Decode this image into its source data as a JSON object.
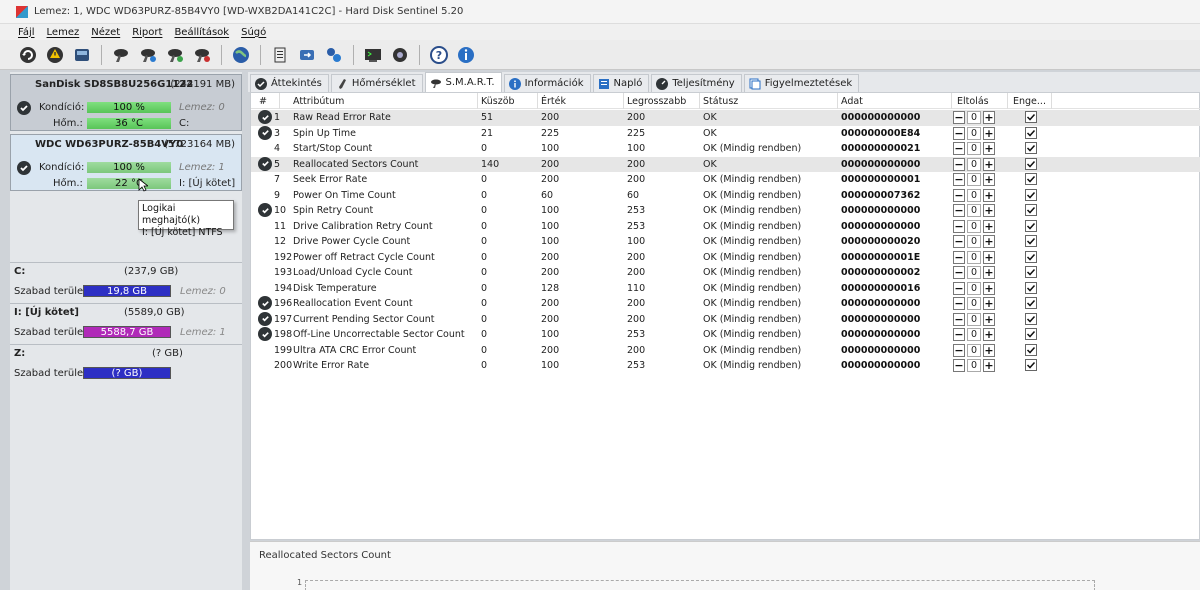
{
  "window": {
    "title": "Lemez: 1, WDC WD63PURZ-85B4VY0 [WD-WXB2DA141C2C]  -  Hard Disk Sentinel 5.20"
  },
  "menu": [
    "Fájl",
    "Lemez",
    "Nézet",
    "Riport",
    "Beállítások",
    "Súgó"
  ],
  "toolbar_icons": [
    "refresh-icon",
    "warning-icon",
    "disk-icon",
    "wrench-icon",
    "wrench-blue-icon",
    "wrench-green-icon",
    "wrench-red-icon",
    "globe-icon",
    "document-icon",
    "sync-icon",
    "network-icon",
    "terminal-icon",
    "settings-icon",
    "help-icon",
    "info-icon"
  ],
  "disks": [
    {
      "name": "SanDisk SD8SB8U256G1122",
      "size": "(244191 MB)",
      "condition_label": "Kondíció:",
      "condition": "100 %",
      "condition_right": "Lemez: 0",
      "temp_label": "Hőm.:",
      "temp": "36 °C",
      "temp_right": "C:"
    },
    {
      "name": "WDC WD63PURZ-85B4VY0",
      "size": "(5723164 MB)",
      "condition_label": "Kondíció:",
      "condition": "100 %",
      "condition_right": "Lemez: 1",
      "temp_label": "Hőm.:",
      "temp": "22 °C",
      "temp_right": "I: [Új kötet]"
    }
  ],
  "tooltip": {
    "line1": "Logikai meghajtó(k)",
    "line2": "I: [Új kötet] NTFS"
  },
  "volumes": [
    {
      "name": "C:",
      "size": "(237,9 GB)",
      "free_label": "Szabad terület",
      "free": "19,8 GB",
      "disk": "Lemez: 0",
      "color": "#2d2fc4"
    },
    {
      "name": "I: [Új kötet]",
      "size": "(5589,0 GB)",
      "free_label": "Szabad terület",
      "free": "5588,7 GB",
      "disk": "Lemez: 1",
      "color": "#b02ab8"
    },
    {
      "name": "Z:",
      "size": "(? GB)",
      "free_label": "Szabad terület",
      "free": "(? GB)",
      "disk": "",
      "color": "#2d2fc4"
    }
  ],
  "tabs": [
    "Áttekintés",
    "Hőmérséklet",
    "S.M.A.R.T.",
    "Információk",
    "Napló",
    "Teljesítmény",
    "Figyelmeztetések"
  ],
  "table": {
    "headers": {
      "num": "#",
      "attr": "Attribútum",
      "threshold": "Küszöb",
      "value": "Érték",
      "worst": "Legrosszabb",
      "status": "Státusz",
      "data": "Adat",
      "offset": "Eltolás",
      "enable": "Enge..."
    },
    "rows": [
      {
        "check": true,
        "num": "1",
        "attr": "Raw Read Error Rate",
        "threshold": "51",
        "value": "200",
        "worst": "200",
        "status": "OK",
        "data": "000000000000",
        "offset": "0",
        "sel": true
      },
      {
        "check": true,
        "num": "3",
        "attr": "Spin Up Time",
        "threshold": "21",
        "value": "225",
        "worst": "225",
        "status": "OK",
        "data": "000000000E84",
        "offset": "0",
        "sel": false
      },
      {
        "check": false,
        "num": "4",
        "attr": "Start/Stop Count",
        "threshold": "0",
        "value": "100",
        "worst": "100",
        "status": "OK (Mindig rendben)",
        "data": "000000000021",
        "offset": "0",
        "sel": false
      },
      {
        "check": true,
        "num": "5",
        "attr": "Reallocated Sectors Count",
        "threshold": "140",
        "value": "200",
        "worst": "200",
        "status": "OK",
        "data": "000000000000",
        "offset": "0",
        "sel": true
      },
      {
        "check": false,
        "num": "7",
        "attr": "Seek Error Rate",
        "threshold": "0",
        "value": "200",
        "worst": "200",
        "status": "OK (Mindig rendben)",
        "data": "000000000001",
        "offset": "0",
        "sel": false
      },
      {
        "check": false,
        "num": "9",
        "attr": "Power On Time Count",
        "threshold": "0",
        "value": "60",
        "worst": "60",
        "status": "OK (Mindig rendben)",
        "data": "000000007362",
        "offset": "0",
        "sel": false
      },
      {
        "check": true,
        "num": "10",
        "attr": "Spin Retry Count",
        "threshold": "0",
        "value": "100",
        "worst": "253",
        "status": "OK (Mindig rendben)",
        "data": "000000000000",
        "offset": "0",
        "sel": false
      },
      {
        "check": false,
        "num": "11",
        "attr": "Drive Calibration Retry Count",
        "threshold": "0",
        "value": "100",
        "worst": "253",
        "status": "OK (Mindig rendben)",
        "data": "000000000000",
        "offset": "0",
        "sel": false
      },
      {
        "check": false,
        "num": "12",
        "attr": "Drive Power Cycle Count",
        "threshold": "0",
        "value": "100",
        "worst": "100",
        "status": "OK (Mindig rendben)",
        "data": "000000000020",
        "offset": "0",
        "sel": false
      },
      {
        "check": false,
        "num": "192",
        "attr": "Power off Retract Cycle Count",
        "threshold": "0",
        "value": "200",
        "worst": "200",
        "status": "OK (Mindig rendben)",
        "data": "00000000001E",
        "offset": "0",
        "sel": false
      },
      {
        "check": false,
        "num": "193",
        "attr": "Load/Unload Cycle Count",
        "threshold": "0",
        "value": "200",
        "worst": "200",
        "status": "OK (Mindig rendben)",
        "data": "000000000002",
        "offset": "0",
        "sel": false
      },
      {
        "check": false,
        "num": "194",
        "attr": "Disk Temperature",
        "threshold": "0",
        "value": "128",
        "worst": "110",
        "status": "OK (Mindig rendben)",
        "data": "000000000016",
        "offset": "0",
        "sel": false
      },
      {
        "check": true,
        "num": "196",
        "attr": "Reallocation Event Count",
        "threshold": "0",
        "value": "200",
        "worst": "200",
        "status": "OK (Mindig rendben)",
        "data": "000000000000",
        "offset": "0",
        "sel": false
      },
      {
        "check": true,
        "num": "197",
        "attr": "Current Pending Sector Count",
        "threshold": "0",
        "value": "200",
        "worst": "200",
        "status": "OK (Mindig rendben)",
        "data": "000000000000",
        "offset": "0",
        "sel": false
      },
      {
        "check": true,
        "num": "198",
        "attr": "Off-Line Uncorrectable Sector Count",
        "threshold": "0",
        "value": "100",
        "worst": "253",
        "status": "OK (Mindig rendben)",
        "data": "000000000000",
        "offset": "0",
        "sel": false
      },
      {
        "check": false,
        "num": "199",
        "attr": "Ultra ATA CRC Error Count",
        "threshold": "0",
        "value": "200",
        "worst": "200",
        "status": "OK (Mindig rendben)",
        "data": "000000000000",
        "offset": "0",
        "sel": false
      },
      {
        "check": false,
        "num": "200",
        "attr": "Write Error Rate",
        "threshold": "0",
        "value": "100",
        "worst": "253",
        "status": "OK (Mindig rendben)",
        "data": "000000000000",
        "offset": "0",
        "sel": false
      }
    ]
  },
  "bottom": {
    "title": "Reallocated Sectors Count",
    "axis_label": "1"
  }
}
